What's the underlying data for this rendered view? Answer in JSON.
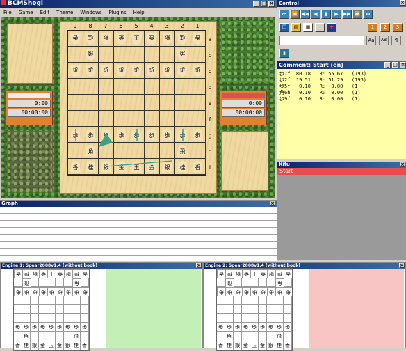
{
  "main": {
    "title": "BCMShogi",
    "menu": [
      "File",
      "Game",
      "Edit",
      "Theme",
      "Windows",
      "Plugins",
      "Help"
    ]
  },
  "board": {
    "files": [
      "9",
      "8",
      "7",
      "6",
      "5",
      "4",
      "3",
      "2",
      "1"
    ],
    "ranks": [
      "a",
      "b",
      "c",
      "d",
      "e",
      "f",
      "g",
      "h",
      "i"
    ],
    "rows": [
      [
        "g:香",
        "g:桂",
        "g:銀",
        "g:金",
        "g:王",
        "g:金",
        "g:銀",
        "g:桂",
        "g:香"
      ],
      [
        "",
        "g:飛",
        "",
        "",
        "",
        "",
        "",
        "g:角",
        ""
      ],
      [
        "g:歩",
        "g:歩",
        "g:歩",
        "g:歩",
        "g:歩",
        "g:歩",
        "g:歩",
        "g:歩",
        "g:歩"
      ],
      [
        "",
        "",
        "",
        "",
        "",
        "",
        "",
        "",
        ""
      ],
      [
        "",
        "",
        "",
        "",
        "",
        "",
        "",
        "",
        ""
      ],
      [
        "",
        "",
        "",
        "",
        "",
        "",
        "",
        "",
        ""
      ],
      [
        "s:歩",
        "s:歩",
        "s:歩",
        "s:歩",
        "s:歩",
        "s:歩",
        "s:歩",
        "s:歩",
        "s:歩"
      ],
      [
        "",
        "s:角",
        "",
        "",
        "",
        "",
        "",
        "s:飛",
        ""
      ],
      [
        "s:香",
        "s:桂",
        "s:銀",
        "s:金",
        "s:玉",
        "s:金",
        "s:銀",
        "s:桂",
        "s:香"
      ]
    ],
    "arrows_colors": {
      "green": "#40a080",
      "teal": "#3a9a9a"
    }
  },
  "clocks": {
    "left": {
      "move_time": "0:00",
      "total_time": "00:00:00"
    },
    "right": {
      "move_time": "0:00",
      "total_time": "00:00:00"
    },
    "right_bar_color": "#e05050"
  },
  "graph": {
    "title": "Graph"
  },
  "control": {
    "title": "Control",
    "nav": [
      "⏮",
      "⏪",
      "◀◀",
      "◀",
      "▮",
      "▶",
      "▶▶",
      "⏩",
      "⏭"
    ],
    "search_value": "",
    "aa_label": "Aa",
    "ab_label": "AB"
  },
  "comment": {
    "title": "Comment: Start (en)",
    "lines": [
      "歩7f  80.18   R: 55.67   (793)",
      "歩2f  19.51   R: 51.29   (193)",
      "歩5f   0.10   R:  0.00   (1)",
      "角6h   0.10   R:  0.00   (1)",
      "歩9f   0.10   R:  0.00   (1)"
    ]
  },
  "kifu": {
    "title": "Kifu",
    "items": [
      "Start"
    ],
    "highlight": "#e84c4c"
  },
  "engine1": {
    "title": "Engine 1: Spear2008v1.4 (without book)",
    "panel_color": "#c4f0b8"
  },
  "engine2": {
    "title": "Engine 2: Spear2008v1.4 (without book)",
    "panel_color": "#f8c4c4"
  }
}
